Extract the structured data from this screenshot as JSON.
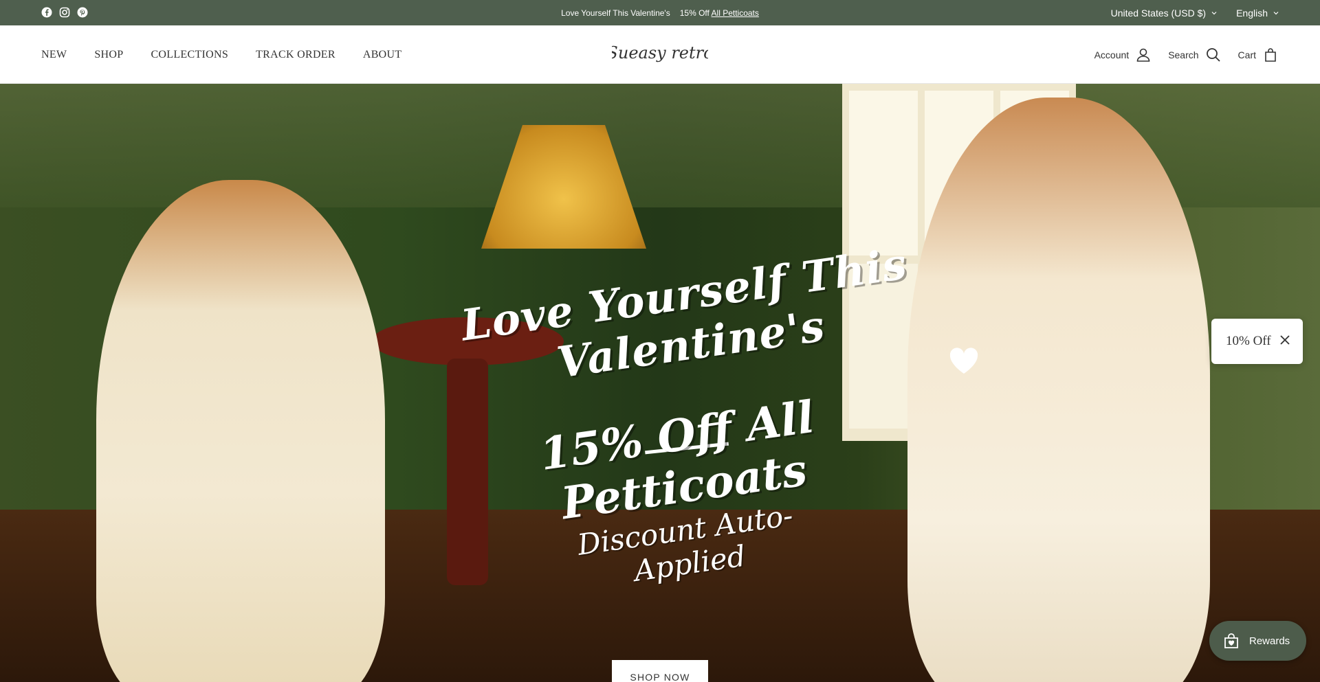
{
  "announcement": {
    "social": [
      "facebook-icon",
      "instagram-icon",
      "pinterest-icon"
    ],
    "message": "Love Yourself This Valentine's",
    "promo_prefix": "15% Off",
    "promo_link": "All Petticoats",
    "country": "United States (USD $)",
    "language": "English"
  },
  "header": {
    "nav": [
      "NEW",
      "SHOP",
      "COLLECTIONS",
      "TRACK ORDER",
      "ABOUT"
    ],
    "logo_text": "Sueasy retro",
    "account_label": "Account",
    "search_label": "Search",
    "cart_label": "Cart"
  },
  "hero": {
    "title": "Love Yourself This Valentine's",
    "subtitle": "15% Off All Petticoats",
    "note": "Discount Auto-Applied",
    "cta": "SHOP NOW"
  },
  "popups": {
    "discount": "10% Off",
    "rewards": "Rewards"
  },
  "colors": {
    "announce_bg": "#4f5f4e",
    "rewards_bg": "#4d5c4b"
  }
}
